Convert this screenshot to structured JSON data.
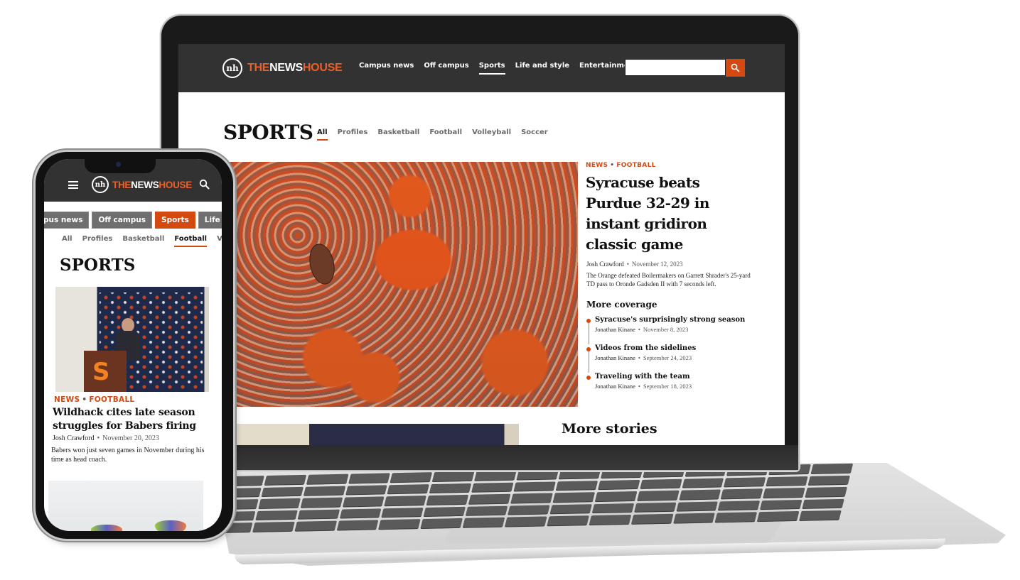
{
  "brand": {
    "name_part1": "THE",
    "name_part2": "NEWS",
    "name_part3": "HOUSE",
    "mark": "nh",
    "accent_color": "#d4490f",
    "logo_orange": "#e8612c",
    "header_bg": "#323232"
  },
  "laptop": {
    "nav": {
      "items": [
        {
          "label": "Campus news",
          "active": false
        },
        {
          "label": "Off campus",
          "active": false
        },
        {
          "label": "Sports",
          "active": true
        },
        {
          "label": "Life and style",
          "active": false
        },
        {
          "label": "Entertainment",
          "active": false
        }
      ],
      "search_value": "",
      "search_icon": "search-icon"
    },
    "page_title": "SPORTS",
    "filter_tabs": [
      {
        "label": "All",
        "active": true
      },
      {
        "label": "Profiles",
        "active": false
      },
      {
        "label": "Basketball",
        "active": false
      },
      {
        "label": "Football",
        "active": false
      },
      {
        "label": "Volleyball",
        "active": false
      },
      {
        "label": "Soccer",
        "active": false
      }
    ],
    "featured": {
      "kicker_section": "NEWS",
      "kicker_topic": "FOOTBALL",
      "headline": "Syracuse beats Purdue 32-29 in instant gridiron classic game",
      "author": "Josh Crawford",
      "date": "November 12, 2023",
      "dek": "The Orange defeated Boilermakers on Garrett Shrader's 25-yard TD pass to Oronde Gadsden II with 7 seconds left."
    },
    "more_coverage": {
      "title": "More coverage",
      "items": [
        {
          "title": "Syracuse's surprisingly strong season",
          "author": "Jonathan Kinane",
          "date": "November 8, 2023"
        },
        {
          "title": "Videos from the sidelines",
          "author": "Jonathan Kinane",
          "date": "September 24, 2023"
        },
        {
          "title": "Traveling with the team",
          "author": "Jonathan Kinane",
          "date": "September 18, 2023"
        }
      ]
    },
    "more_stories_title": "More stories"
  },
  "phone": {
    "section_pills": [
      {
        "label": "pus news",
        "active": false
      },
      {
        "label": "Off campus",
        "active": false
      },
      {
        "label": "Sports",
        "active": true
      },
      {
        "label": "Life and s",
        "active": false
      }
    ],
    "filter_tabs": [
      {
        "label": "All",
        "active": false
      },
      {
        "label": "Profiles",
        "active": false
      },
      {
        "label": "Basketball",
        "active": false
      },
      {
        "label": "Football",
        "active": true
      },
      {
        "label": "Voll",
        "active": false
      }
    ],
    "page_title": "SPORTS",
    "article": {
      "photo_letter": "S",
      "kicker_section": "NEWS",
      "kicker_topic": "FOOTBALL",
      "headline": "Wildhack cites late season struggles for Babers firing",
      "author": "Josh Crawford",
      "date": "November 20, 2023",
      "dek": "Babers won just seven games in November during his time as head coach."
    }
  },
  "separator_dot": "•"
}
